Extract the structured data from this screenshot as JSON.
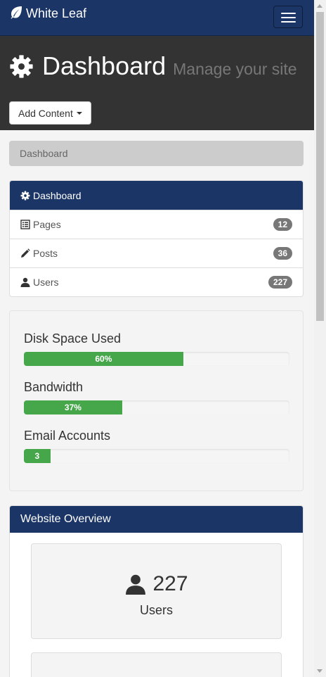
{
  "navbar": {
    "brand": "White Leaf",
    "toggle_icon": "hamburger-icon"
  },
  "header": {
    "title": "Dashboard",
    "subtitle": "Manage your site",
    "add_button": "Add Content"
  },
  "breadcrumb": {
    "current": "Dashboard"
  },
  "menu": {
    "heading": "Dashboard",
    "items": [
      {
        "label": "Pages",
        "count": "12",
        "icon": "list-icon"
      },
      {
        "label": "Posts",
        "count": "36",
        "icon": "pencil-icon"
      },
      {
        "label": "Users",
        "count": "227",
        "icon": "user-icon"
      }
    ]
  },
  "stats": [
    {
      "label": "Disk Space Used",
      "value": 60,
      "text": "60%"
    },
    {
      "label": "Bandwidth",
      "value": 37,
      "text": "37%"
    },
    {
      "label": "Email Accounts",
      "value": 10,
      "text": "3"
    }
  ],
  "overview": {
    "heading": "Website Overview",
    "cards": [
      {
        "number": "227",
        "label": "Users",
        "icon": "user-icon"
      }
    ]
  },
  "colors": {
    "navy": "#1a3566",
    "dark": "#333333",
    "green": "#45a74a",
    "badge": "#777777"
  }
}
